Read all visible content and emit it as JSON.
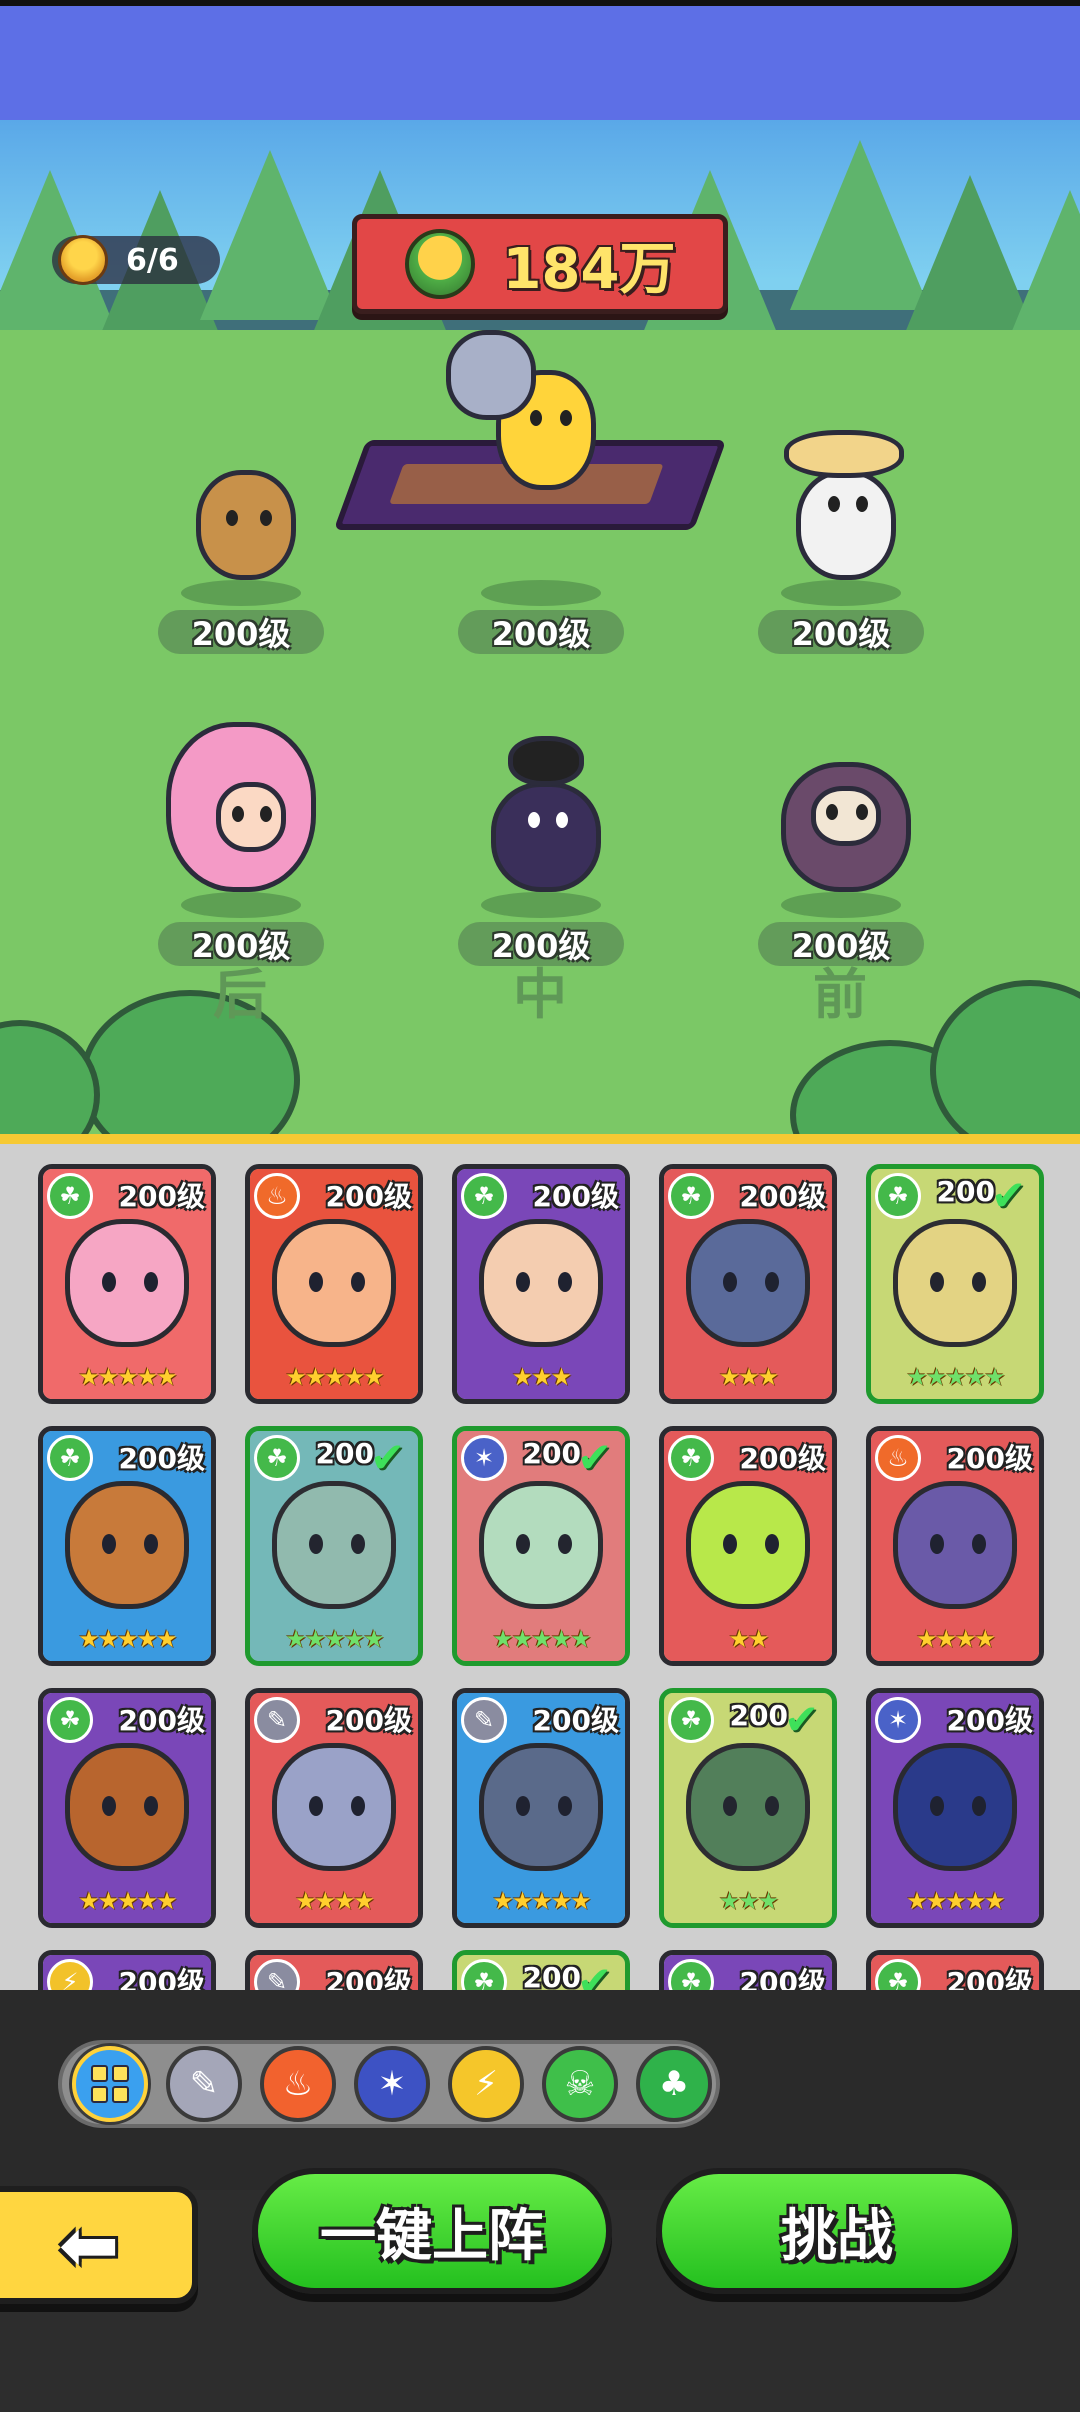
{
  "header": {
    "team_count": "6/6",
    "power": "184万"
  },
  "formation": {
    "slots": [
      {
        "row": "后",
        "level": "200级",
        "hero": "antler-bear",
        "color": "#c8914a"
      },
      {
        "row": "中",
        "level": "200级",
        "hero": "chicken-shield-carpet",
        "color": "#ffd43a"
      },
      {
        "row": "前",
        "level": "200级",
        "hero": "duck-straw-hat",
        "color": "#f2f2f2"
      },
      {
        "row": "后",
        "level": "200级",
        "hero": "mermaid-trident",
        "color": "#f49ac6"
      },
      {
        "row": "中",
        "level": "200级",
        "hero": "plague-crow",
        "color": "#3a2f5a"
      },
      {
        "row": "前",
        "level": "200级",
        "hero": "owl-knight",
        "color": "#6a4a6a"
      }
    ],
    "row_labels": [
      "后",
      "中",
      "前"
    ]
  },
  "cards": [
    {
      "level": "200级",
      "element": "grass",
      "bg": "pink",
      "stars": 5,
      "selected": false,
      "skin": "#f6a6c4"
    },
    {
      "level": "200级",
      "element": "fire",
      "bg": "orange",
      "stars": 5,
      "selected": false,
      "skin": "#f7b48a"
    },
    {
      "level": "200级",
      "element": "grass",
      "bg": "purple",
      "stars": 3,
      "selected": false,
      "skin": "#f4cdb0"
    },
    {
      "level": "200级",
      "element": "grass",
      "bg": "red",
      "stars": 3,
      "selected": false,
      "skin": "#5a6a9a"
    },
    {
      "level": "200",
      "element": "grass",
      "bg": "lime",
      "stars": 5,
      "selected": true,
      "skin": "#d9c45a"
    },
    {
      "level": "200级",
      "element": "grass",
      "bg": "blue",
      "stars": 5,
      "selected": false,
      "skin": "#c87a3a"
    },
    {
      "level": "200",
      "element": "grass",
      "bg": "teal",
      "stars": 5,
      "selected": true,
      "skin": "#7ab0a0"
    },
    {
      "level": "200",
      "element": "ice",
      "bg": "pink",
      "stars": 5,
      "selected": true,
      "skin": "#9ad0a8"
    },
    {
      "level": "200级",
      "element": "grass",
      "bg": "red",
      "stars": 2,
      "selected": false,
      "skin": "#b8e84a"
    },
    {
      "level": "200级",
      "element": "fire",
      "bg": "red",
      "stars": 4,
      "selected": false,
      "skin": "#6a5aa8"
    },
    {
      "level": "200级",
      "element": "grass",
      "bg": "purple",
      "stars": 5,
      "selected": false,
      "skin": "#b8652e"
    },
    {
      "level": "200级",
      "element": "wind",
      "bg": "red",
      "stars": 4,
      "selected": false,
      "skin": "#9aa2c8"
    },
    {
      "level": "200级",
      "element": "wind",
      "bg": "blue",
      "stars": 5,
      "selected": false,
      "skin": "#5a6a8a"
    },
    {
      "level": "200",
      "element": "grass",
      "bg": "lime",
      "stars": 3,
      "selected": true,
      "skin": "#3f7a4a"
    },
    {
      "level": "200级",
      "element": "ice",
      "bg": "purple",
      "stars": 5,
      "selected": false,
      "skin": "#2a3a8a"
    },
    {
      "level": "200级",
      "element": "bolt",
      "bg": "purple",
      "stars": 0,
      "selected": false,
      "skin": "#7a4ab8"
    },
    {
      "level": "200级",
      "element": "wind",
      "bg": "red",
      "stars": 0,
      "selected": false,
      "skin": "#e45a5a"
    },
    {
      "level": "200",
      "element": "grass",
      "bg": "lime",
      "stars": 0,
      "selected": true,
      "skin": "#8ac850"
    },
    {
      "level": "200级",
      "element": "grass",
      "bg": "purple",
      "stars": 0,
      "selected": false,
      "skin": "#e8a040"
    },
    {
      "level": "200级",
      "element": "grass",
      "bg": "red",
      "stars": 0,
      "selected": false,
      "skin": "#f2c22a"
    }
  ],
  "filters": [
    {
      "name": "filter-all",
      "icon": "grid-icon",
      "active": true
    },
    {
      "name": "filter-wind",
      "icon": "feather-icon",
      "active": false
    },
    {
      "name": "filter-fire",
      "icon": "flame-icon",
      "active": false
    },
    {
      "name": "filter-ice",
      "icon": "snowflake-icon",
      "active": false
    },
    {
      "name": "filter-bolt",
      "icon": "lightning-icon",
      "active": false
    },
    {
      "name": "filter-grass",
      "icon": "skull-leaf-icon",
      "active": false
    },
    {
      "name": "filter-mushroom",
      "icon": "mushroom-icon",
      "active": false
    }
  ],
  "buttons": {
    "auto_deploy": "一键上阵",
    "challenge": "挑战",
    "back_icon": "arrow-left-icon"
  }
}
